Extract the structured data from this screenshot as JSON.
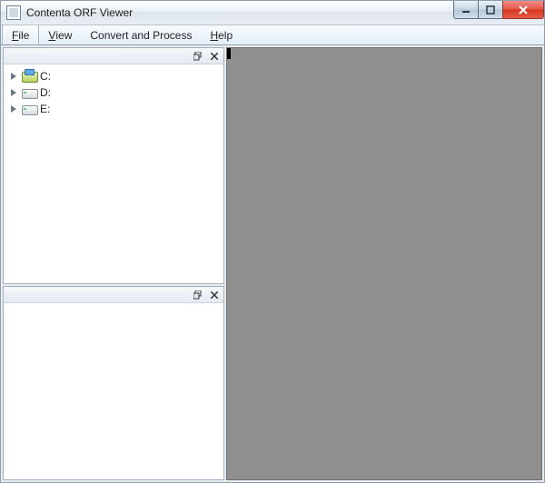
{
  "window": {
    "title": "Contenta ORF Viewer"
  },
  "menubar": {
    "items": [
      {
        "label": "File",
        "mnemonic_index": 0,
        "active": true
      },
      {
        "label": "View",
        "mnemonic_index": 0,
        "active": false
      },
      {
        "label": "Convert and Process",
        "mnemonic_index": -1,
        "active": false
      },
      {
        "label": "Help",
        "mnemonic_index": 0,
        "active": false
      }
    ]
  },
  "tree": {
    "drives": [
      {
        "label": "C:",
        "icon": "sys"
      },
      {
        "label": "D:",
        "icon": "hdd"
      },
      {
        "label": "E:",
        "icon": "hdd"
      }
    ]
  }
}
